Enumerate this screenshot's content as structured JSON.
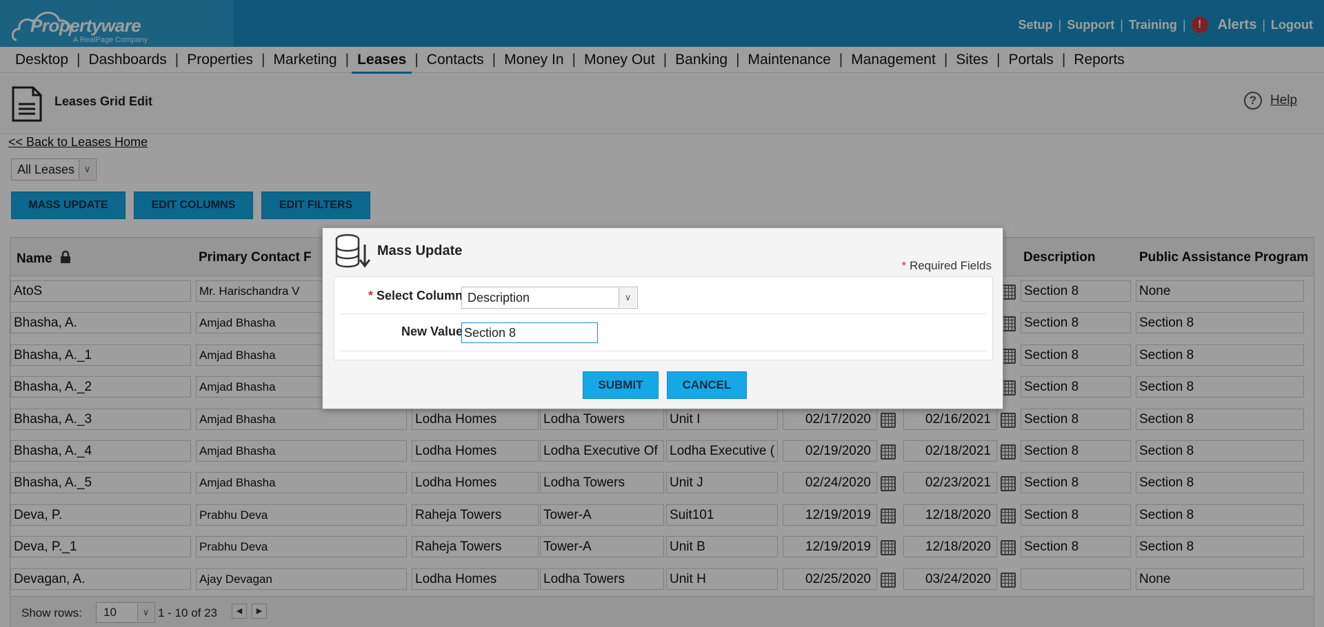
{
  "header": {
    "logo_text": "Propertyware",
    "logo_sub": "A RealPage Company",
    "links": [
      "Setup",
      "Support",
      "Training"
    ],
    "alerts_label": "Alerts",
    "alerts_badge": "!",
    "logout_label": "Logout"
  },
  "nav": {
    "items": [
      "Desktop",
      "Dashboards",
      "Properties",
      "Marketing",
      "Leases",
      "Contacts",
      "Money In",
      "Money Out",
      "Banking",
      "Maintenance",
      "Management",
      "Sites",
      "Portals",
      "Reports"
    ],
    "active": "Leases"
  },
  "page": {
    "title": "Leases Grid Edit",
    "help_label": "Help",
    "back_link": "<< Back to Leases Home",
    "lease_filter": "All Leases",
    "buttons": {
      "mass_update": "MASS UPDATE",
      "edit_columns": "EDIT COLUMNS",
      "edit_filters": "EDIT FILTERS"
    }
  },
  "grid": {
    "headers": {
      "name": "Name",
      "primary_contact": "Primary Contact F",
      "description": "Description",
      "public_assistance": "Public Assistance Program"
    },
    "rows": [
      {
        "name": "AtoS",
        "contact": "Mr. Harischandra V",
        "portfolio": "",
        "building": "",
        "unit": "",
        "start": "",
        "end": "",
        "description": "Section 8",
        "program": "None"
      },
      {
        "name": "Bhasha, A.",
        "contact": "Amjad Bhasha",
        "portfolio": "",
        "building": "",
        "unit": "",
        "start": "",
        "end": "",
        "description": "Section 8",
        "program": "Section 8"
      },
      {
        "name": "Bhasha, A._1",
        "contact": "Amjad Bhasha",
        "portfolio": "",
        "building": "",
        "unit": "",
        "start": "",
        "end": "",
        "description": "Section 8",
        "program": "Section 8"
      },
      {
        "name": "Bhasha, A._2",
        "contact": "Amjad Bhasha",
        "portfolio": "",
        "building": "",
        "unit": "",
        "start": "",
        "end": "",
        "description": "Section 8",
        "program": "Section 8"
      },
      {
        "name": "Bhasha, A._3",
        "contact": "Amjad Bhasha",
        "portfolio": "Lodha Homes",
        "building": "Lodha Towers",
        "unit": "Unit I",
        "start": "02/17/2020",
        "end": "02/16/2021",
        "description": "Section 8",
        "program": "Section 8"
      },
      {
        "name": "Bhasha, A._4",
        "contact": "Amjad Bhasha",
        "portfolio": "Lodha Homes",
        "building": "Lodha Executive Of",
        "unit": "Lodha Executive (",
        "start": "02/19/2020",
        "end": "02/18/2021",
        "description": "Section 8",
        "program": "Section 8"
      },
      {
        "name": "Bhasha, A._5",
        "contact": "Amjad Bhasha",
        "portfolio": "Lodha Homes",
        "building": "Lodha Towers",
        "unit": "Unit J",
        "start": "02/24/2020",
        "end": "02/23/2021",
        "description": "Section 8",
        "program": "Section 8"
      },
      {
        "name": "Deva, P.",
        "contact": "Prabhu Deva",
        "portfolio": "Raheja Towers",
        "building": "Tower-A",
        "unit": "Suit101",
        "start": "12/19/2019",
        "end": "12/18/2020",
        "description": "Section 8",
        "program": "Section 8"
      },
      {
        "name": "Deva, P._1",
        "contact": "Prabhu Deva",
        "portfolio": "Raheja Towers",
        "building": "Tower-A",
        "unit": "Unit B",
        "start": "12/19/2019",
        "end": "12/18/2020",
        "description": "Section 8",
        "program": "Section 8"
      },
      {
        "name": "Devagan, A.",
        "contact": "Ajay Devagan",
        "portfolio": "Lodha Homes",
        "building": "Lodha Towers",
        "unit": "Unit H",
        "start": "02/25/2020",
        "end": "03/24/2020",
        "description": "",
        "program": "None"
      }
    ],
    "footer": {
      "show_rows_label": "Show rows:",
      "rows_value": "10",
      "paging_text": "1 - 10 of 23"
    }
  },
  "modal": {
    "title": "Mass Update",
    "required_note": "Required Fields",
    "required_star": "*",
    "select_column_label": "Select Column",
    "select_column_value": "Description",
    "new_value_label": "New Value",
    "new_value": "Section 8",
    "submit_label": "SUBMIT",
    "cancel_label": "CANCEL"
  },
  "colors": {
    "brand": "#1a8fc3",
    "button": "#16a8e6",
    "alert": "#d0313a"
  }
}
